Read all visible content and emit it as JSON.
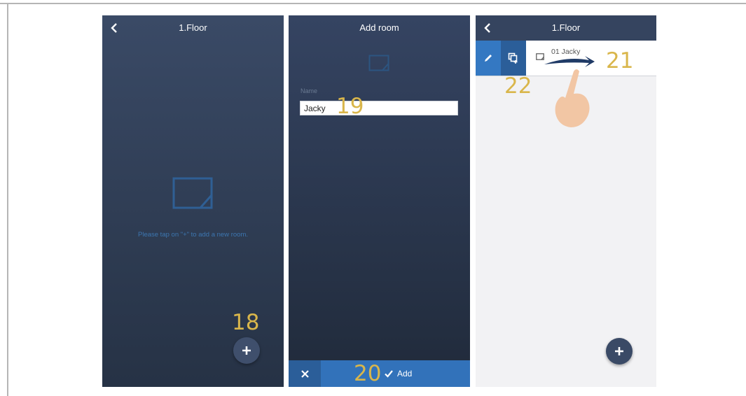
{
  "panel1": {
    "title": "1.Floor",
    "hint": "Please tap on \"+\" to add a new room.",
    "callout": "18"
  },
  "panel2": {
    "title": "Add room",
    "name_label": "Name",
    "name_value": "Jacky",
    "callout_input": "19",
    "callout_bar": "20",
    "add_label": "Add"
  },
  "panel3": {
    "title": "1.Floor",
    "room_label": "01 Jacky",
    "callout_swipe": "21",
    "callout_copy": "22"
  },
  "colors": {
    "dark_blue": "#35445f",
    "accent_blue": "#3272ba",
    "callout_gold": "#d9b64b",
    "hint_blue": "#3c76b0"
  }
}
